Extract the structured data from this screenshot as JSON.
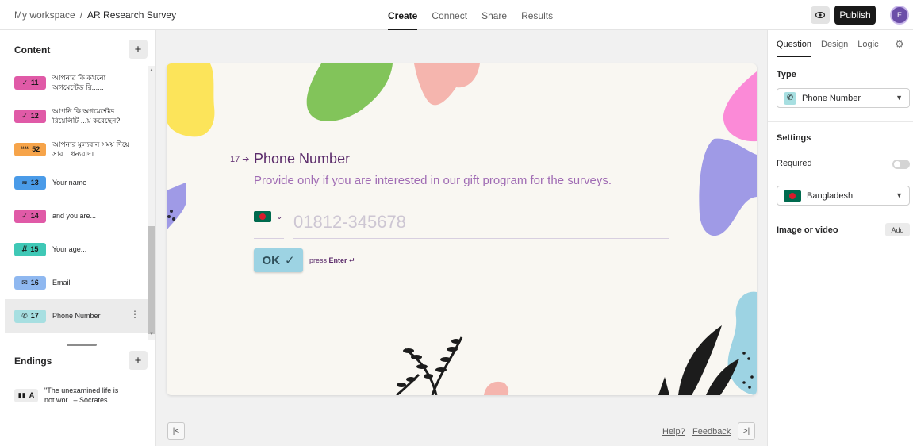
{
  "breadcrumb": {
    "workspace": "My workspace",
    "separator": "/",
    "form": "AR Research Survey"
  },
  "nav_tabs": [
    "Create",
    "Connect",
    "Share",
    "Results"
  ],
  "header": {
    "publish_label": "Publish",
    "avatar_initial": "E"
  },
  "left": {
    "content_title": "Content",
    "endings_title": "Endings",
    "items": [
      {
        "num": "11",
        "text": "আপনার কি কখনো অগমেন্টেড রি......",
        "icon": "check-icon",
        "color": "#e05aa7"
      },
      {
        "num": "12",
        "text": "আপনি কি অগমেন্টেড রিয়েলিটি ...য় করেছেন?",
        "icon": "check-icon",
        "color": "#e05aa7"
      },
      {
        "num": "52",
        "text": "আপনার মূল্যবান সময় দিয়ে সার... ধন্যবাদ।",
        "icon": "quote-icon",
        "color": "#f6a44a"
      },
      {
        "num": "13",
        "text": "Your name",
        "icon": "short-text-icon",
        "color": "#4a9be8"
      },
      {
        "num": "14",
        "text": "and you are...",
        "icon": "check-icon",
        "color": "#e05aa7"
      },
      {
        "num": "15",
        "text": "Your age...",
        "icon": "hash-icon",
        "color": "#3fc8b6"
      },
      {
        "num": "16",
        "text": "Email",
        "icon": "mail-icon",
        "color": "#8fb8f0"
      },
      {
        "num": "17",
        "text": "Phone Number",
        "icon": "phone-icon",
        "color": "#a7dfe1"
      }
    ],
    "ending": {
      "letter": "A",
      "text": "\"The unexamined life is not wor...– Socrates"
    }
  },
  "question": {
    "number": "17",
    "title": "Phone Number",
    "description": "Provide only if you are interested in our gift program for the surveys.",
    "placeholder": "01812-345678",
    "ok_label": "OK",
    "press_prefix": "press",
    "press_key": "Enter ↵"
  },
  "canvas_footer": {
    "help": "Help?",
    "feedback": "Feedback"
  },
  "right": {
    "tabs": [
      "Question",
      "Design",
      "Logic"
    ],
    "type_label": "Type",
    "type_value": "Phone Number",
    "settings_label": "Settings",
    "required_label": "Required",
    "required_on": false,
    "country_value": "Bangladesh",
    "media_label": "Image or video",
    "add_label": "Add"
  },
  "colors": {
    "accent_text": "#5a2a6a",
    "ok_button": "#9dd3e3",
    "card_bg": "#f9f7f2"
  }
}
